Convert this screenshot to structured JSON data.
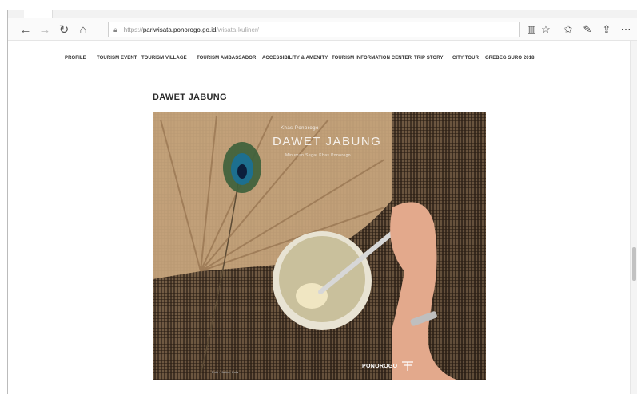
{
  "browser": {
    "address": {
      "scheme": "https://",
      "host": "pariwisata.ponorogo.go.id",
      "path": "/wisata-kuliner/"
    },
    "icons": [
      "back-icon",
      "forward-icon",
      "refresh-icon",
      "home-icon",
      "lock-icon",
      "reading-view-icon",
      "favorite-icon",
      "favorites-icon",
      "pen-icon",
      "share-icon",
      "more-icon"
    ]
  },
  "site": {
    "menu": [
      "PROFILE",
      "TOURISM EVENT",
      "TOURISM VILLAGE",
      "TOURISM AMBASSADOR",
      "ACCESSIBILITY & AMENITY",
      "TOURISM INFORMATION CENTER",
      "TRIP STORY",
      "CITY TOUR",
      "GREBEG SURO 2018"
    ],
    "page_title": "DAWET JABUNG",
    "photo": {
      "caption_small": "Khas Ponorogo",
      "caption_large": "DAWET JABUNG",
      "caption_sub": "Minuman Segar Khas Ponorogo",
      "credit": "Foto : Kuliner Kota",
      "logo": "PONOROGO"
    }
  },
  "colors": {
    "accent_text": "#2a2a2a",
    "frame": "#bbbbbb"
  }
}
